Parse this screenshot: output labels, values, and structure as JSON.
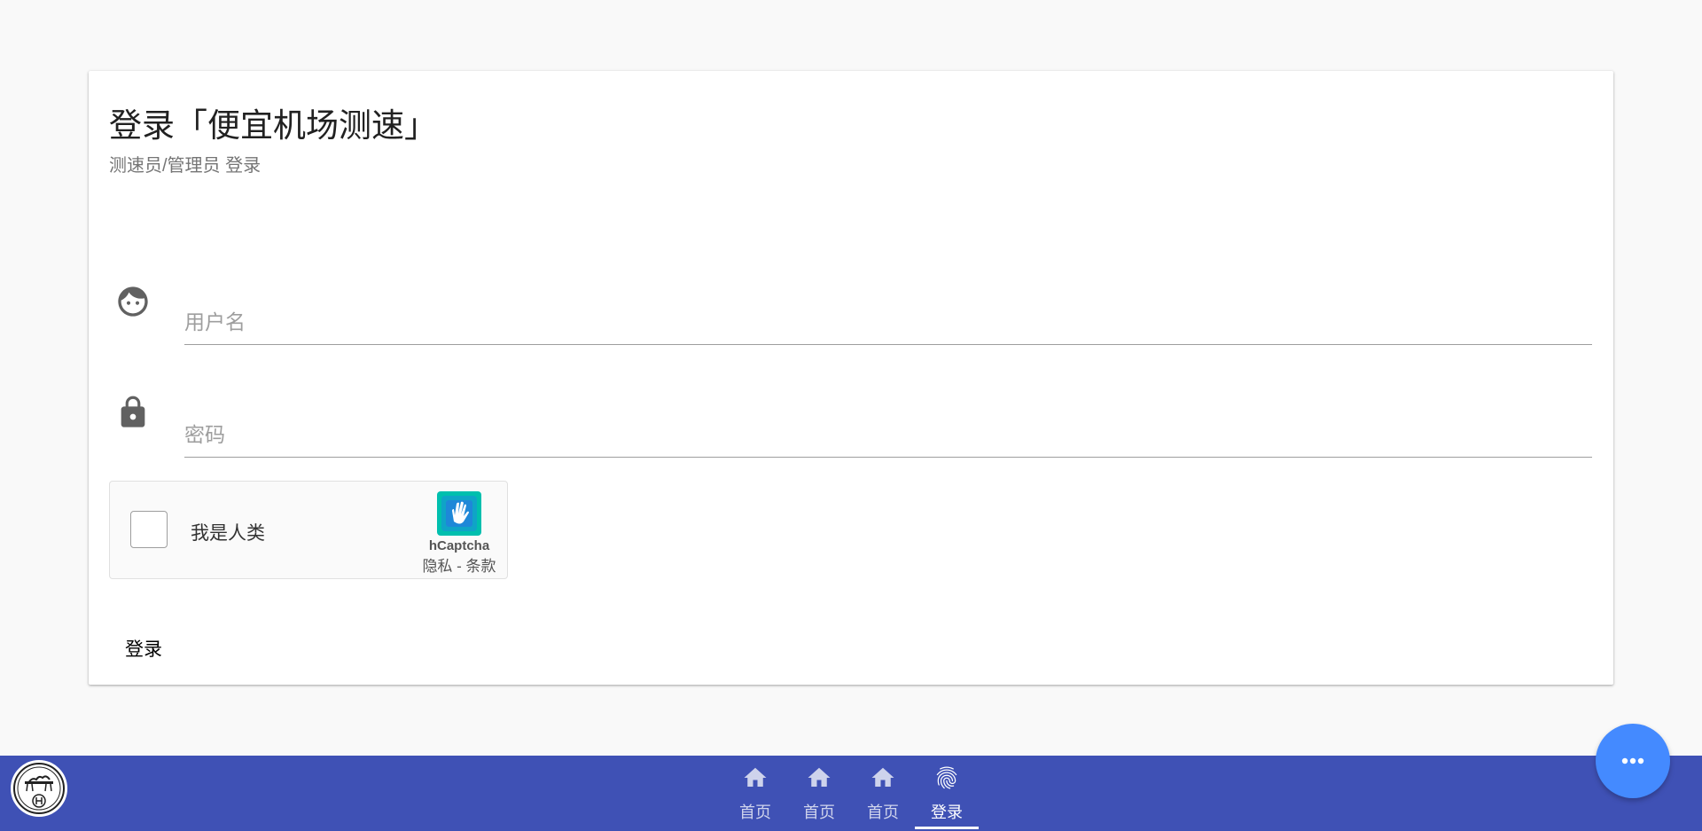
{
  "card": {
    "title": "登录「便宜机场测速」",
    "subtitle": "测速员/管理员 登录"
  },
  "form": {
    "username_icon": "face-icon",
    "username_placeholder": "用户名",
    "username_value": "",
    "password_icon": "lock-icon",
    "password_placeholder": "密码",
    "password_value": ""
  },
  "captcha": {
    "checkbox_label": "我是人类",
    "checked": false,
    "brand": "hCaptcha",
    "privacy_link": "隐私",
    "separator": " - ",
    "terms_link": "条款"
  },
  "actions": {
    "login_label": "登录"
  },
  "bottom_nav": {
    "items": [
      {
        "label": "首页",
        "icon": "home-icon",
        "active": false
      },
      {
        "label": "首页",
        "icon": "home-icon",
        "active": false
      },
      {
        "label": "首页",
        "icon": "home-icon",
        "active": false
      },
      {
        "label": "登录",
        "icon": "fingerprint-icon",
        "active": true
      }
    ]
  },
  "fab": {
    "icon": "more-horizontal-icon"
  },
  "colors": {
    "nav_background": "#3f51b5",
    "fab_background": "#448aff",
    "page_background": "#f9f9f9"
  }
}
